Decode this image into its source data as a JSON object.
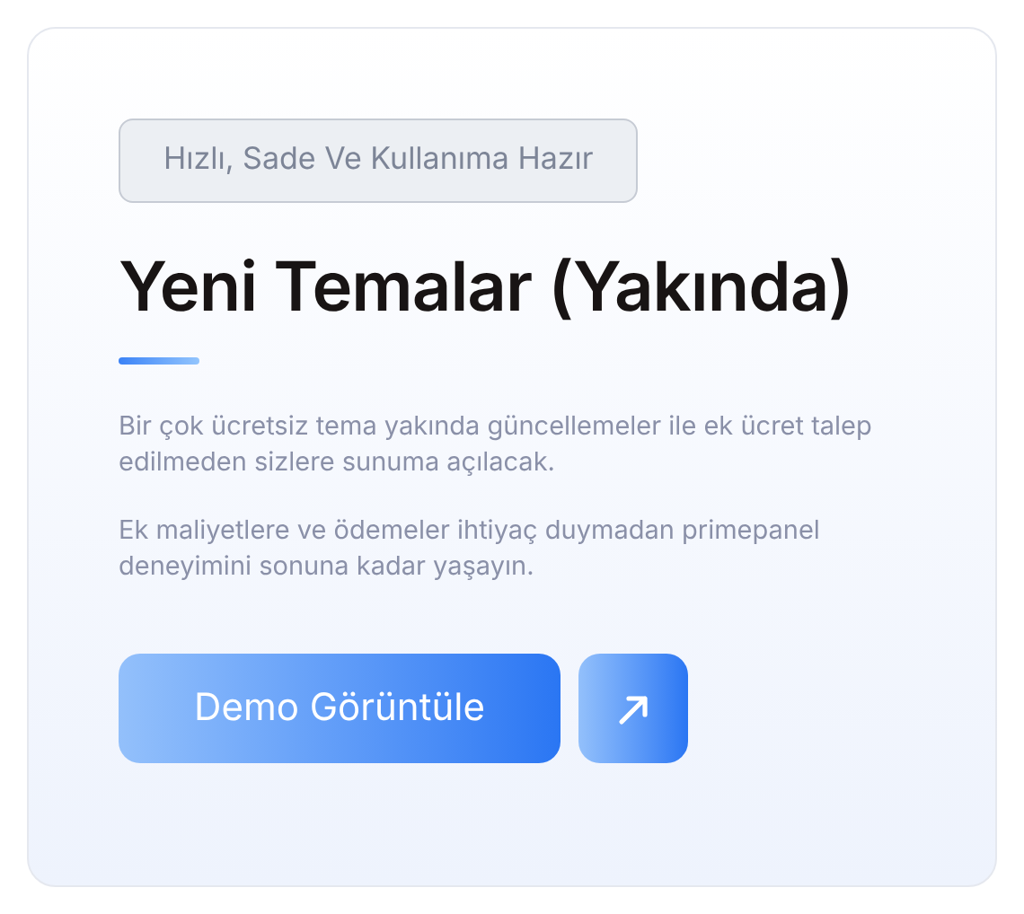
{
  "card": {
    "badge": "Hızlı, Sade Ve Kullanıma Hazır",
    "title": "Yeni Temalar (Yakında)",
    "paragraphs": [
      "Bir çok ücretsiz tema yakında güncellemeler ile ek ücret talep edilmeden sizlere sunuma açılacak.",
      "Ek maliyetlere ve ödemeler ihtiyaç duymadan primepanel deneyimini sonuna kadar yaşayın."
    ],
    "primary_button": "Demo Görüntüle"
  }
}
